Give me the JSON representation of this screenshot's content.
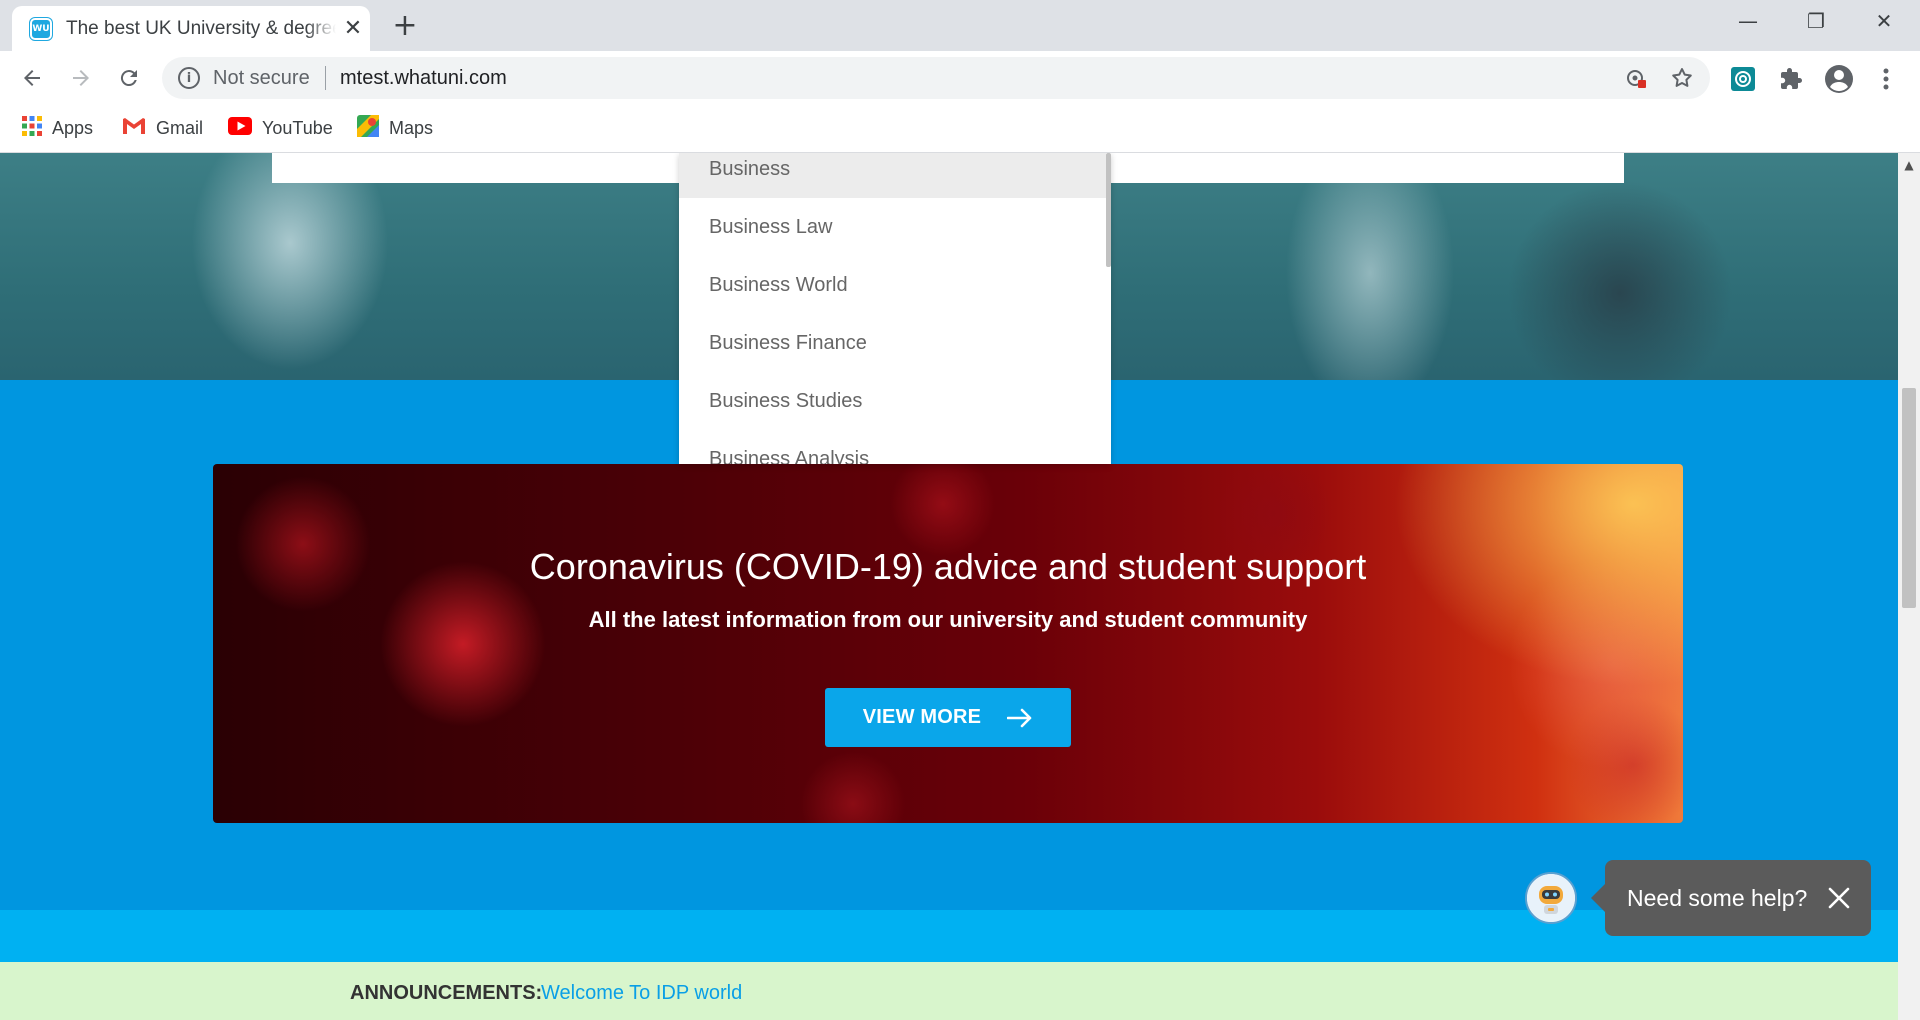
{
  "browser": {
    "tab_title": "The best UK University & degree",
    "favicon_text": "WU",
    "close_tab_glyph": "✕",
    "new_tab_glyph": "+",
    "window_controls": {
      "minimize": "—",
      "restore": "❐",
      "close": "✕"
    },
    "address": {
      "security_label": "Not secure",
      "url": "mtest.whatuni.com"
    },
    "icons": [
      "back-icon",
      "forward-icon",
      "reload-icon",
      "info-icon",
      "tracking-protection-icon",
      "star-icon",
      "extension-app-icon",
      "puzzle-icon",
      "profile-icon",
      "menu-icon"
    ]
  },
  "bookmarks": [
    {
      "label": "Apps",
      "icon": "apps-grid-icon"
    },
    {
      "label": "Gmail",
      "icon": "gmail-icon"
    },
    {
      "label": "YouTube",
      "icon": "youtube-icon"
    },
    {
      "label": "Maps",
      "icon": "maps-icon"
    }
  ],
  "dropdown": {
    "items": [
      "Business",
      "Business Law",
      "Business World",
      "Business Finance",
      "Business Studies",
      "Business Analysis"
    ],
    "highlighted_index": 0
  },
  "covid_banner": {
    "title": "Coronavirus (COVID-19) advice and student support",
    "subtitle": "All the latest information from our university and student community",
    "button_label": "VIEW MORE"
  },
  "chat": {
    "prompt": "Need some help?"
  },
  "announcement": {
    "label": "ANNOUNCEMENTS:",
    "link_text": "Welcome To IDP world"
  },
  "colors": {
    "brand_blue": "#0096e0",
    "button_blue": "#0aa6ea",
    "announce_bg": "#d8f5cc",
    "link_blue": "#0a9fe6"
  }
}
